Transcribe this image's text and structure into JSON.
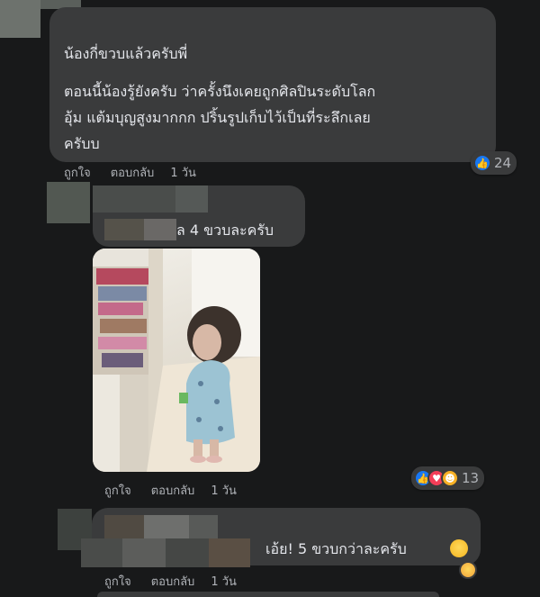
{
  "comments": [
    {
      "lines": [
        "น้องกี่ขวบแล้วครับพี่",
        "ตอนนี้น้องรู้ยังครับ ว่าครั้งนึงเคยถูกศิลปินระดับโลก",
        "อุ้ม แต้มบุญสูงมากกก ปริ้นรูปเก็บไว้เป็นที่ระลึกเลย",
        "ครับบ"
      ],
      "like_label": "ถูกใจ",
      "reply_label": "ตอบกลับ",
      "time": "1 วัน",
      "reaction_count": "24",
      "reactions": [
        "like-icon"
      ]
    },
    {
      "text_suffix": "ล 4 ขวบละครับ",
      "like_label": "ถูกใจ",
      "reply_label": "ตอบกลับ",
      "time": "1 วัน",
      "reaction_count": "13",
      "reactions": [
        "like-icon",
        "love-icon",
        "haha-icon"
      ]
    },
    {
      "text": "เอ้ย! 5 ขวบกว่าละครับ",
      "like_label": "ถูกใจ",
      "reply_label": "ตอบกลับ",
      "time": "1 วัน",
      "reactions": [
        "grin-sweat-emoji",
        "kiss-emoji"
      ]
    }
  ],
  "colors": {
    "background": "#18191a",
    "bubble": "#3a3b3c",
    "text": "#e4e6eb",
    "secondary_text": "#b0b3b8",
    "like_blue": "#1877f2",
    "love_red": "#f33e58"
  }
}
